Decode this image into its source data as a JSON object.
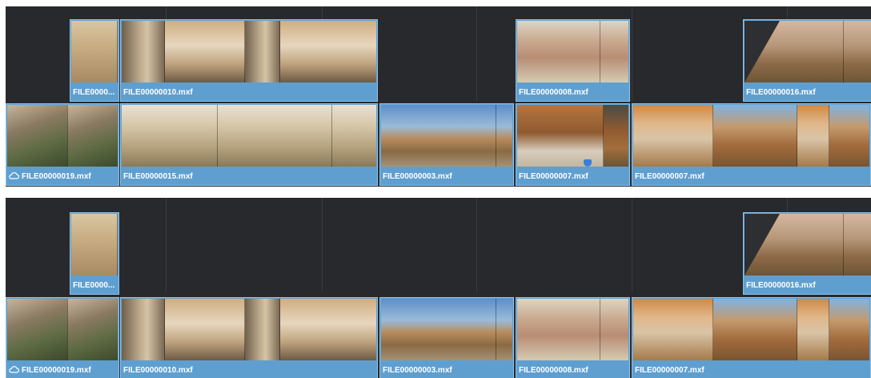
{
  "top_timeline": {
    "upper_track": [
      {
        "label": "FILE0000...",
        "thumbs": [
          "trail"
        ]
      },
      {
        "label": "FILE00000010.mxf",
        "thumbs": [
          "pole",
          "woman",
          "pole",
          "woman"
        ]
      },
      {
        "label": "FILE00000008.mxf",
        "thumbs": [
          "hands",
          "hands"
        ]
      },
      {
        "label": "FILE00000016.mxf",
        "thumbs": [
          "rockfence",
          "rockfence"
        ]
      }
    ],
    "lower_track": [
      {
        "label": "FILE00000019.mxf",
        "cloud": true,
        "thumbs": [
          "rocks",
          "rocks"
        ]
      },
      {
        "label": "FILE00000015.mxf",
        "thumbs": [
          "desert",
          "desert",
          "desert"
        ]
      },
      {
        "label": "FILE00000003.mxf",
        "thumbs": [
          "cabinsky",
          "cabinsky"
        ]
      },
      {
        "label": "FILE00000007.mxf",
        "thumbs": [
          "shed",
          "shed2"
        ]
      },
      {
        "label": "FILE00000007.mxf",
        "thumbs": [
          "hero",
          "heroblue",
          "hero",
          "heroblue"
        ]
      }
    ]
  },
  "bottom_timeline": {
    "upper_track": [
      {
        "label": "FILE0000...",
        "thumbs": [
          "trail"
        ]
      },
      {
        "label": "FILE00000016.mxf",
        "thumbs": [
          "rockfence",
          "rockfence"
        ]
      }
    ],
    "lower_track": [
      {
        "label": "FILE00000019.mxf",
        "cloud": true,
        "thumbs": [
          "rocks",
          "rocks"
        ]
      },
      {
        "label": "FILE00000010.mxf",
        "thumbs": [
          "pole",
          "woman",
          "pole",
          "woman"
        ]
      },
      {
        "label": "FILE00000003.mxf",
        "thumbs": [
          "cabinsky",
          "cabinsky"
        ]
      },
      {
        "label": "FILE00000008.mxf",
        "thumbs": [
          "hands",
          "hands"
        ]
      },
      {
        "label": "FILE00000007.mxf",
        "thumbs": [
          "hero",
          "heroblue",
          "hero",
          "heroblue"
        ]
      }
    ]
  },
  "colors": {
    "clip_fill": "#5f9fd0",
    "clip_border": "#8fc3ea",
    "timeline_bg": "#28292c",
    "marker": "#3a7fd9"
  }
}
